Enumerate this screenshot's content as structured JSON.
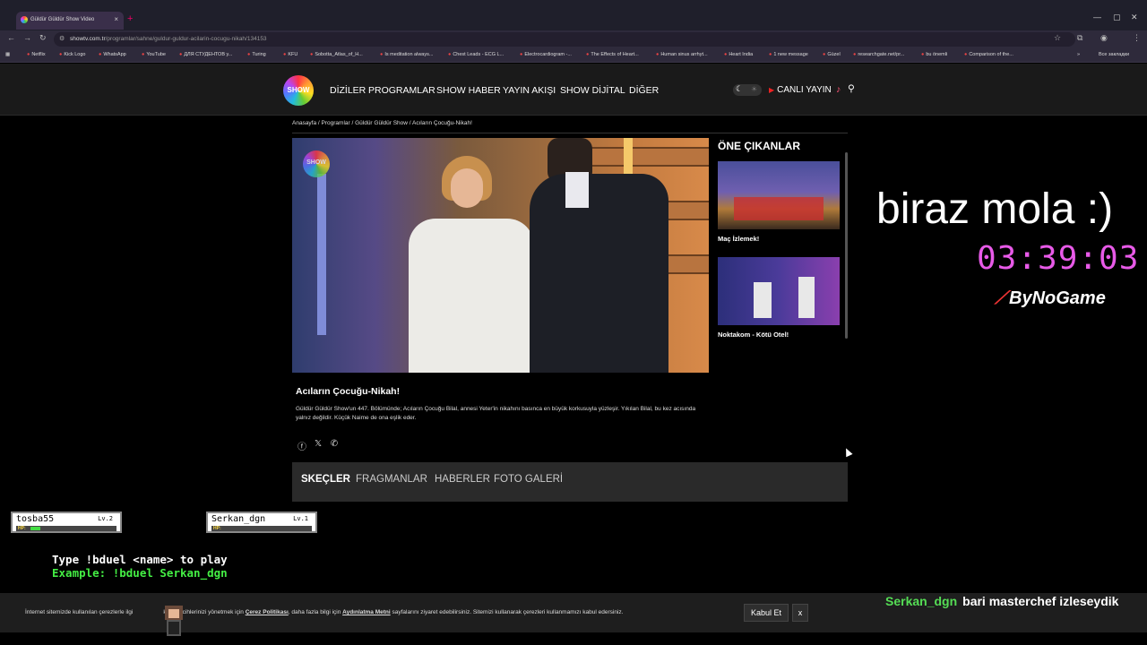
{
  "browser": {
    "tab_title": "Güldür Güldür Show Video",
    "url_host": "showtv.com.tr",
    "url_path": "/programlar/sahne/guldur-guldur-acilarin-cocugu-nikah/134153",
    "bookmarks": [
      "Netflix",
      "Kick Logo",
      "WhatsApp",
      "YouTube",
      "ДЛЯ СТУДЕНТОВ у...",
      "Turing",
      "KFU",
      "Sobotta_Atlas_of_H...",
      "Is meditation always...",
      "Chest Leads - ECG L...",
      "Electrocardiogram -...",
      "The Effects of Heart...",
      "Human sinus arrhyt...",
      "Heart India",
      "1 new message",
      "Güzel",
      "researchgate.net/pr...",
      "bu önemli",
      "Comparison of the..."
    ],
    "bookmarks_more": "Все закладки"
  },
  "site": {
    "logo_text": "SHOW",
    "menu": [
      "DİZİLER",
      "PROGRAMLAR",
      "SHOW HABER",
      "YAYIN AKIŞI",
      "SHOW DİJİTAL",
      "DİĞER"
    ],
    "live_label": "CANLI YAYIN"
  },
  "breadcrumb": "Anasayfa / Programlar / Güldür Güldür Show / Acıların Çocuğu-Nikah!",
  "episode": {
    "title": "Acıların Çocuğu-Nikah!",
    "description": "Güldür Güldür Show'un 447. Bölümünde; Acıların Çocuğu Bilal, annesi Yeter'in nikahını basınca en büyük korkusuyla yüzleşir. Yıkılan Bilal, bu kez acısında yalnız değildir. Küçük Naime de ona eşlik eder.",
    "video_logo": "SHOW"
  },
  "sidebar": {
    "title": "ÖNE ÇIKANLAR",
    "items": [
      {
        "caption": "Maç İzlemek!"
      },
      {
        "caption": "Noktakom - Kötü Otel!"
      }
    ]
  },
  "tabs": [
    "SKEÇLER",
    "FRAGMANLAR",
    "HABERLER",
    "FOTO GALERİ"
  ],
  "overlay": {
    "mola_text": "biraz mola :)",
    "timer": "03:39:03",
    "brand": "ByNoGame",
    "player1": {
      "name": "tosba55",
      "level": "Lv.2",
      "hp": 0.12
    },
    "player2": {
      "name": "Serkan_dgn",
      "level": "Lv.1",
      "hp": 0.0
    },
    "hp_label": "HP:",
    "duel_line1": "Type !bduel <name> to play",
    "duel_line2": "Example: !bduel Serkan_dgn",
    "chat_user": "Serkan_dgn",
    "chat_message": "bari masterchef izleseydik"
  },
  "cookie": {
    "text_start": "İnternet sitemizde kullanılan çerezlerle ilgi",
    "text_mid": "k ve tercihlerinizi yönetmek için ",
    "link1": "Çerez Politikası",
    "text_mid2": ", daha fazla bilgi için ",
    "link2": "Aydınlatma Metni",
    "text_end": " sayfalarını ziyaret edebilirsiniz. Sitemizi kullanarak çerezleri kullanmamızı kabul edersiniz.",
    "accept": "Kabul Et",
    "close": "x"
  },
  "colors": {
    "timer": "#e85ae8",
    "chat_user": "#55dd55",
    "duel_example": "#44ee44"
  }
}
